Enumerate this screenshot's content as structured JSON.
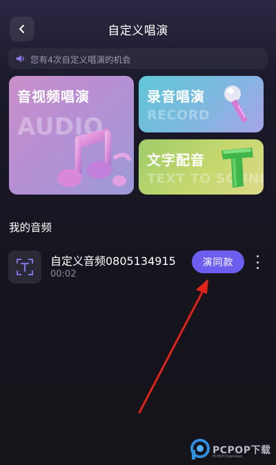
{
  "header": {
    "title": "自定义唱演"
  },
  "notice": {
    "text": "您有4次自定义唱演的机会"
  },
  "cards": {
    "audio_video": {
      "title": "音视频唱演",
      "subtitle": "AUDIO"
    },
    "record": {
      "title": "录音唱演",
      "subtitle": "RECORD"
    },
    "text_dub": {
      "title": "文字配音",
      "subtitle": "TEXT TO SOUND"
    }
  },
  "section": {
    "title": "我的音频"
  },
  "audios": [
    {
      "name": "自定义音频0805134915",
      "duration": "00:02",
      "action_label": "演同款"
    }
  ],
  "watermark": {
    "brand": "PCPOP下载",
    "small": "PCPOP Download"
  },
  "colors": {
    "accent": "#6e5ef0",
    "annotation_arrow": "#e2231a"
  },
  "icons": [
    "back-icon",
    "speaker-icon",
    "music-note-icon",
    "microphone-icon",
    "letter-t-icon",
    "text-icon",
    "more-icon"
  ]
}
